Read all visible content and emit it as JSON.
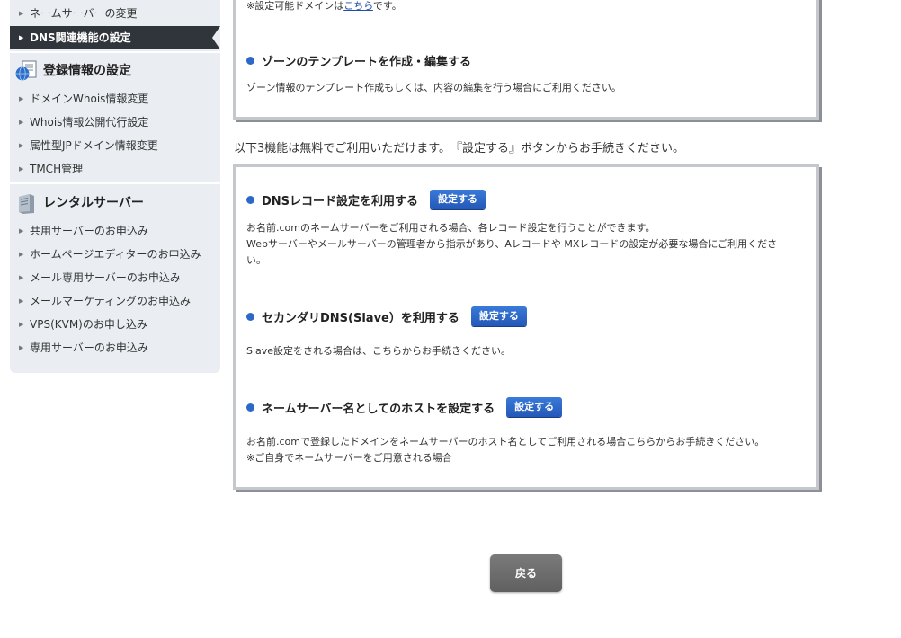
{
  "sidebar": {
    "items_top": [
      {
        "label": "ネームサーバーの変更"
      },
      {
        "label": "DNS関連機能の設定",
        "active": true
      }
    ],
    "section_registration": {
      "title": "登録情報の設定",
      "items": [
        {
          "label": "ドメインWhois情報変更"
        },
        {
          "label": "Whois情報公開代行設定"
        },
        {
          "label": "属性型JPドメイン情報変更"
        },
        {
          "label": "TMCH管理"
        }
      ]
    },
    "section_rental": {
      "title": "レンタルサーバー",
      "items": [
        {
          "label": "共用サーバーのお申込み"
        },
        {
          "label": "ホームページエディターのお申込み"
        },
        {
          "label": "メール専用サーバーのお申込み"
        },
        {
          "label": "メールマーケティングのお申込み"
        },
        {
          "label": "VPS(KVM)のお申し込み"
        },
        {
          "label": "専用サーバーのお申込み"
        }
      ]
    }
  },
  "top_panel": {
    "notice_prefix": "※設定可能ドメインは",
    "notice_link": "こちら",
    "notice_suffix": "です。",
    "zone_title": "ゾーンのテンプレートを作成・編集する",
    "zone_desc": "ゾーン情報のテンプレート作成もしくは、内容の編集を行う場合にご利用ください。"
  },
  "intro_text": "以下3機能は無料でご利用いただけます。　『設定する』ボタンからお手続きください。",
  "features": [
    {
      "title": "DNSレコード設定を利用する",
      "button": "設定する",
      "desc_lines": [
        "お名前.comのネームサーバーをご利用される場合、各レコード設定を行うことができます。",
        "Webサーバーやメールサーバーの管理者から指示があり、Aレコードや MXレコードの設定が必要な場合にご利用くださ",
        "い。"
      ]
    },
    {
      "title": "セカンダリDNS(Slave）を利用する",
      "button": "設定する",
      "desc_lines": [
        "Slave設定をされる場合は、こちらからお手続きください。"
      ]
    },
    {
      "title": "ネームサーバー名としてのホストを設定する",
      "button": "設定する",
      "desc_lines": [
        "お名前.comで登録したドメインをネームサーバーのホスト名としてご利用される場合こちらからお手続きください。",
        "※ご自身でネームサーバーをご用意される場合"
      ]
    }
  ],
  "back_button": "戻る",
  "colors": {
    "accent_blue": "#2b68c8",
    "sidebar_bg": "#eaeef3",
    "active_bg": "#30343b"
  }
}
